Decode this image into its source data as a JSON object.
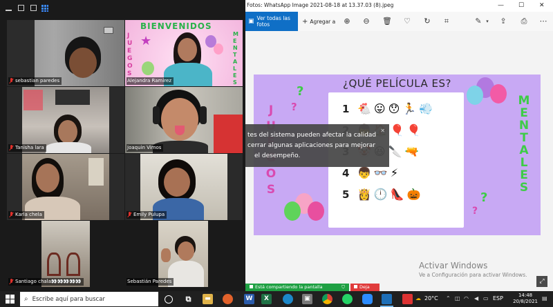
{
  "zoom": {
    "participants": [
      {
        "name": "sebastian paredes",
        "muted": true,
        "tile_label": ""
      },
      {
        "name": "Alejandra Ramirez",
        "muted": false,
        "tile_label": ""
      },
      {
        "name": "Tanisha lara",
        "muted": true
      },
      {
        "name": "Joaquin Vimos",
        "muted": false
      },
      {
        "name": "Karla chela",
        "muted": true
      },
      {
        "name": "Emily Pulupa",
        "muted": true
      },
      {
        "name": "Santiago chala👀👀👀👀👀",
        "muted": true
      },
      {
        "name": "Sebastián Paredes",
        "muted": false
      }
    ],
    "bienvenidos_banner": {
      "title": "BIENVENIDOS",
      "left_word": "JUEGOS",
      "right_word": "MENTALES"
    }
  },
  "photos": {
    "window_title": "Fotos: WhatsApp Image 2021-08-18 at 13.37.03 (8).jpeg",
    "toolbar": {
      "see_all_label": "Ver todas las fotos",
      "add_label": "Agregar a"
    },
    "quiz": {
      "title": "¿QUÉ PELÍCULA ES?",
      "left_word": [
        "J",
        "U",
        "E",
        "G",
        "O",
        "S"
      ],
      "right_word": [
        "M",
        "E",
        "N",
        "T",
        "A",
        "L",
        "E",
        "S"
      ],
      "rows": [
        {
          "num": "1",
          "emojis": [
            "🐔",
            "😛",
            "😯",
            "🏃",
            "💨"
          ]
        },
        {
          "num": "2",
          "emojis": [
            "👦",
            "🏠",
            "🎈",
            "🎈"
          ]
        },
        {
          "num": "3",
          "emojis": [
            "🤡",
            "😆",
            "🔪",
            "🔫"
          ]
        },
        {
          "num": "4",
          "emojis": [
            "👦",
            "👓",
            "⚡"
          ]
        },
        {
          "num": "5",
          "emojis": [
            "👸",
            "🕛",
            "👠",
            "🎃"
          ]
        }
      ]
    }
  },
  "notification": {
    "text": "tes del sistema pueden afectar la calidad cerrar algunas aplicaciones para mejorar el desempeño.",
    "line1": "tes del sistema pueden afectar la calidad",
    "line2": "cerrar algunas aplicaciones para mejorar",
    "line3": "el desempeño.",
    "close": "✕"
  },
  "activation": {
    "title": "Activar Windows",
    "subtitle": "Ve a Configuración para activar Windows."
  },
  "share": {
    "message": "Está compartiendo la pantalla",
    "stop_label": "Deja de"
  },
  "taskbar": {
    "search_placeholder": "Escribe aquí para buscar",
    "temperature": "20°C",
    "language": "ESP",
    "time": "14:48",
    "date": "20/8/2021"
  },
  "colors": {
    "quiz_bg": "#c8a9f4",
    "accent_blue": "#0f6fc6",
    "share_green": "#1fa043",
    "stop_red": "#e03b3b",
    "active_speaker": "#d8e05a"
  }
}
